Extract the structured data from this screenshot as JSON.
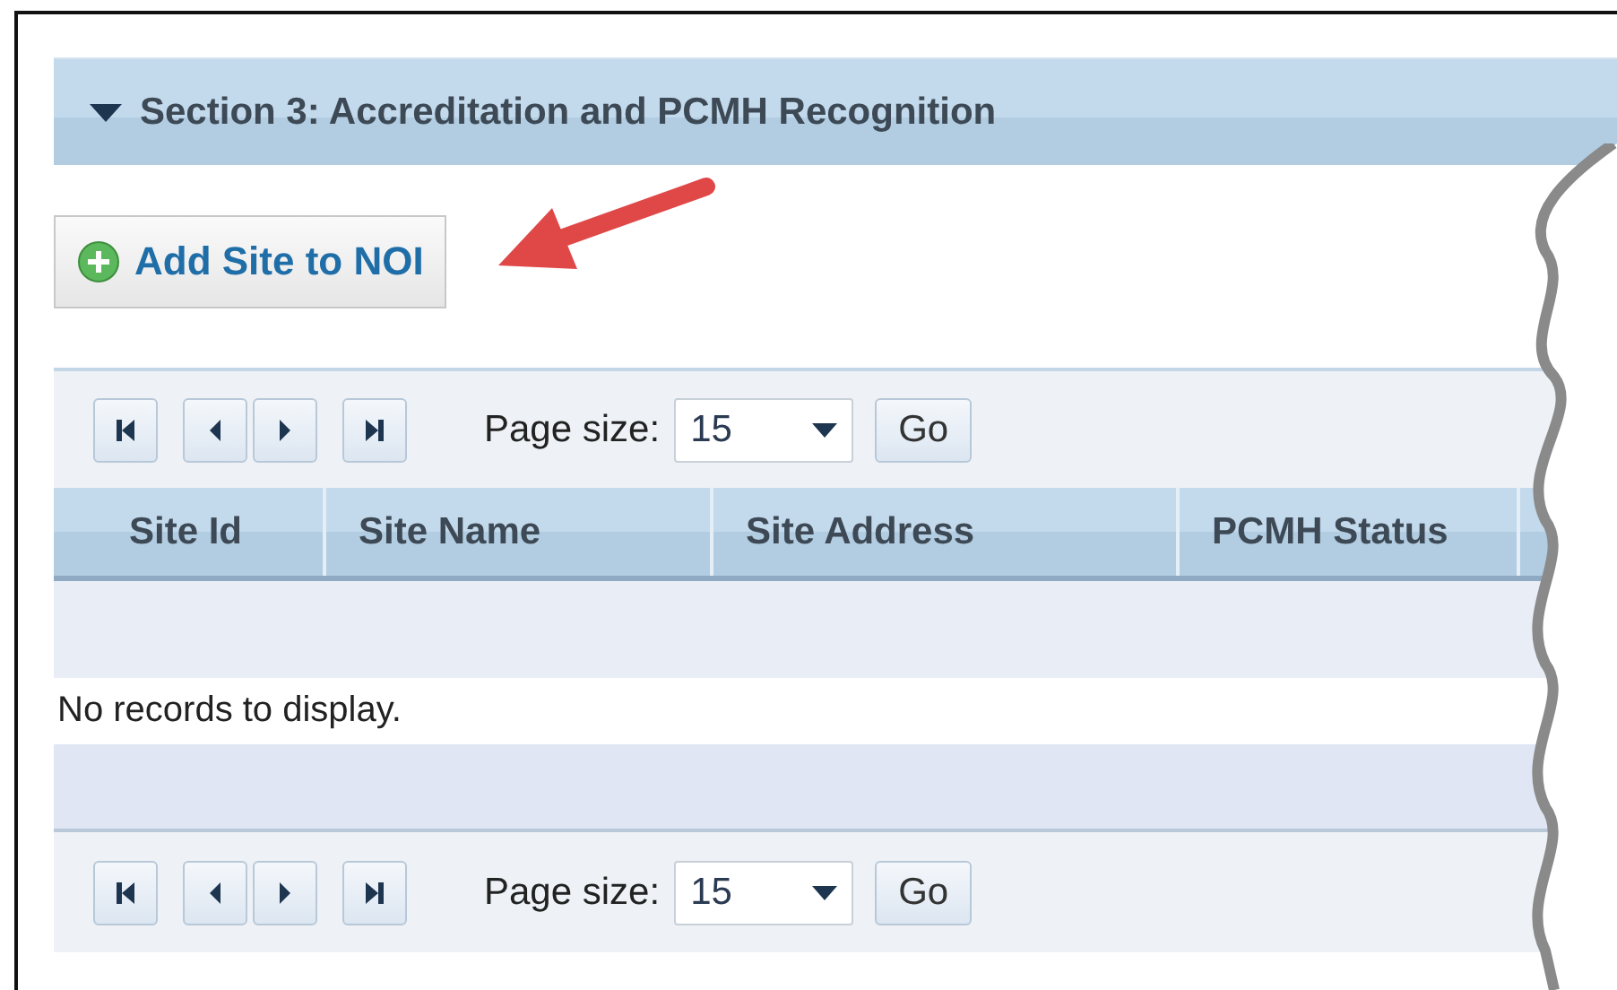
{
  "section": {
    "title": "Section 3: Accreditation and PCMH Recognition",
    "expanded": true
  },
  "add_button": {
    "label": "Add Site to NOI"
  },
  "top_pager": {
    "page_size_label": "Page size:",
    "page_size": "15",
    "go": "Go"
  },
  "table": {
    "columns": [
      "Site Id",
      "Site Name",
      "Site Address",
      "PCMH Status"
    ],
    "empty_message": "No records to display."
  },
  "bottom_pager": {
    "page_size_label": "Page size:",
    "page_size": "15",
    "go": "Go"
  }
}
